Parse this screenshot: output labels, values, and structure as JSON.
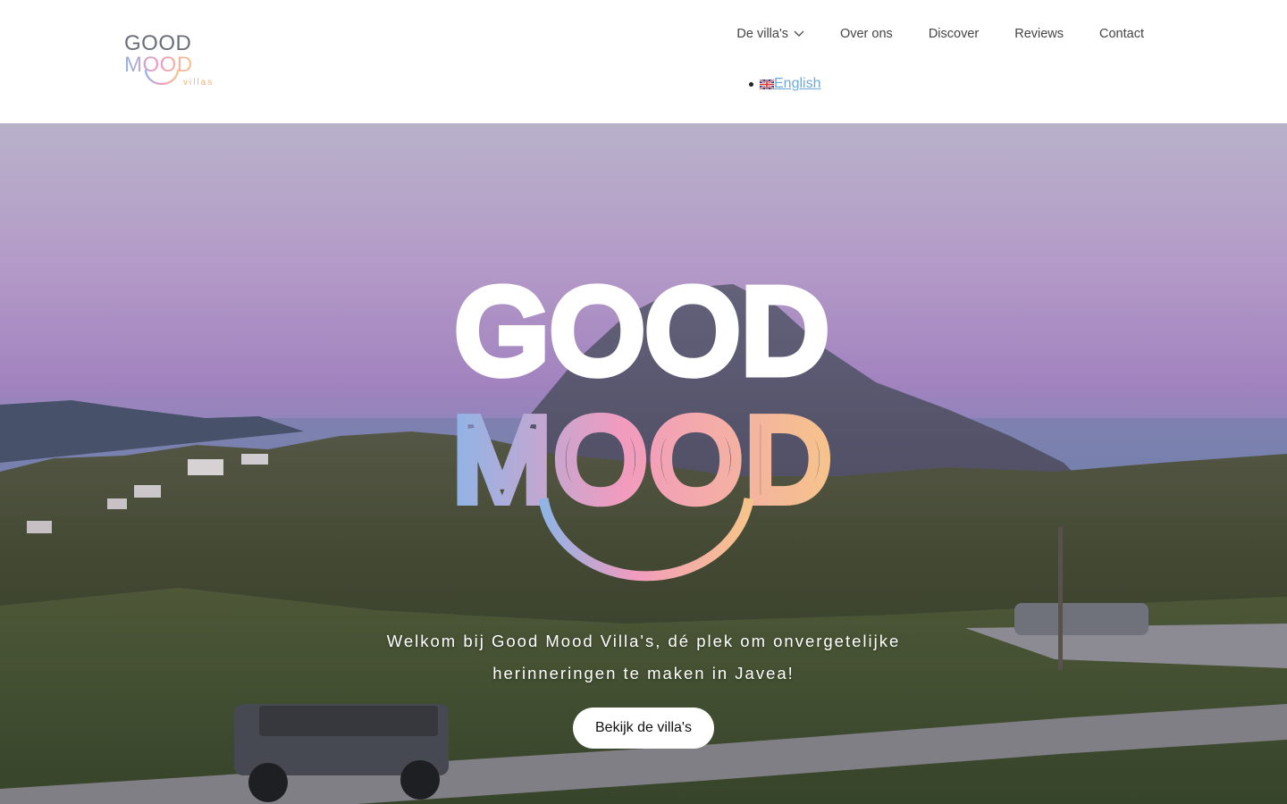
{
  "brand": {
    "logo_text_top": "GOOD",
    "logo_text_bottom": "MOOD",
    "logo_subtext": "villas",
    "colors": {
      "grey": "#6b6e78",
      "blue": "#8fb4e6",
      "pink": "#f29bbe",
      "orange": "#f6c48a"
    }
  },
  "nav": {
    "items": [
      {
        "label": "De villa's",
        "has_dropdown": true,
        "icon": "chevron-down-icon"
      },
      {
        "label": "Over ons"
      },
      {
        "label": "Discover"
      },
      {
        "label": "Reviews"
      },
      {
        "label": "Contact"
      }
    ],
    "language": {
      "label": "English",
      "icon": "uk-flag-icon"
    }
  },
  "hero": {
    "logo_top": "GOOD",
    "logo_bottom": "MOOD",
    "tagline_line1": "Welkom bij Good Mood Villa's, dé plek om onvergetelijke",
    "tagline_line2": "herinneringen te maken in Javea!",
    "cta_label": "Bekijk de villa's"
  }
}
